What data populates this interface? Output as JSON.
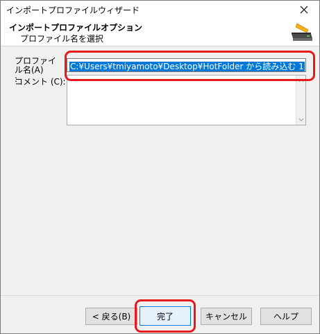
{
  "window": {
    "title": "インポートプロファイルウィザード"
  },
  "header": {
    "title": "インポートプロファイルオプション",
    "subtitle": "プロファイル名を選択"
  },
  "form": {
    "name_label": "プロファイル名(A)\n:",
    "name_value": "C:¥Users¥tmiyamoto¥Desktop¥HotFolder から読み込む 1",
    "comment_label": "コメント (C):",
    "comment_value": ""
  },
  "buttons": {
    "back": "< 戻る(B)",
    "finish": "完了",
    "cancel": "キャンセル",
    "help": "ヘルプ"
  },
  "colors": {
    "highlight": "#e8191d",
    "selection": "#0078d7",
    "dialog_bg": "#f0f0f0"
  },
  "icons": {
    "close": "close-icon",
    "header": "scanner-icon"
  }
}
